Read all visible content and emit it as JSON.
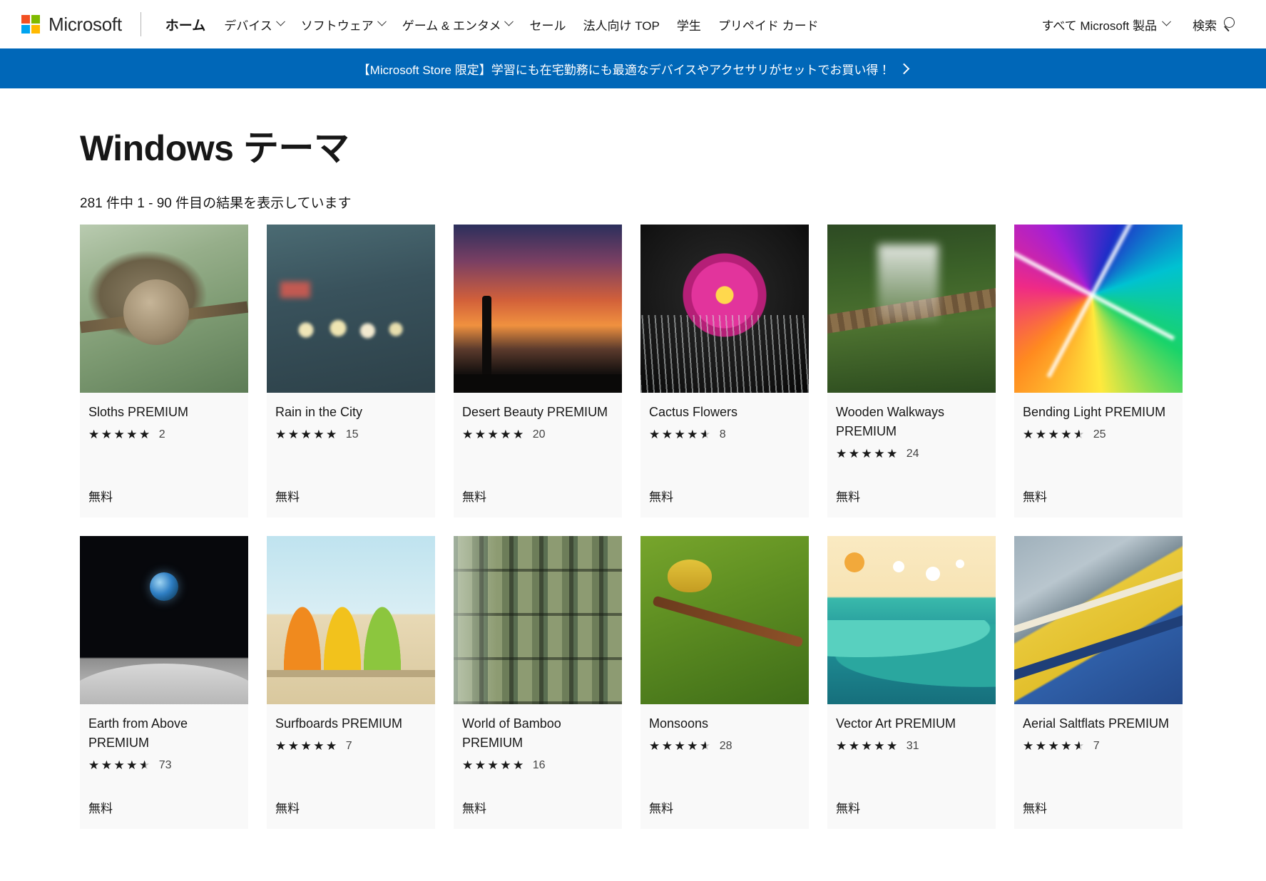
{
  "header": {
    "brand": "Microsoft",
    "logo_icon": "microsoft-logo-icon",
    "nav": [
      {
        "label": "ホーム",
        "has_chevron": false,
        "current": true
      },
      {
        "label": "デバイス",
        "has_chevron": true,
        "current": false
      },
      {
        "label": "ソフトウェア",
        "has_chevron": true,
        "current": false
      },
      {
        "label": "ゲーム & エンタメ",
        "has_chevron": true,
        "current": false
      },
      {
        "label": "セール",
        "has_chevron": false,
        "current": false
      },
      {
        "label": "法人向け TOP",
        "has_chevron": false,
        "current": false
      },
      {
        "label": "学生",
        "has_chevron": false,
        "current": false
      },
      {
        "label": "プリペイド カード",
        "has_chevron": false,
        "current": false
      }
    ],
    "all_microsoft": "すべて Microsoft 製品",
    "search_label": "検索",
    "search_icon": "search-icon"
  },
  "promo": {
    "text": "【Microsoft Store 限定】学習にも在宅勤務にも最適なデバイスやアクセサリがセットでお買い得！",
    "arrow_icon": "chevron-right-icon",
    "background": "#0067b8"
  },
  "page": {
    "title": "Windows テーマ",
    "results_text": "281 件中 1 - 90 件目の結果を表示しています"
  },
  "products": [
    {
      "title": "Sloths PREMIUM",
      "rating": 5,
      "rating_count": "2",
      "price": "無料",
      "art": "art-sloth",
      "thumb_name": "thumbnail-sloths"
    },
    {
      "title": "Rain in the City",
      "rating": 5,
      "rating_count": "15",
      "price": "無料",
      "art": "art-rain",
      "thumb_name": "thumbnail-rain-in-the-city"
    },
    {
      "title": "Desert Beauty PREMIUM",
      "rating": 5,
      "rating_count": "20",
      "price": "無料",
      "art": "art-desert",
      "thumb_name": "thumbnail-desert-beauty"
    },
    {
      "title": "Cactus Flowers",
      "rating": 4.5,
      "rating_count": "8",
      "price": "無料",
      "art": "art-cactus",
      "thumb_name": "thumbnail-cactus-flowers"
    },
    {
      "title": "Wooden Walkways PREMIUM",
      "rating": 5,
      "rating_count": "24",
      "price": "無料",
      "art": "art-walkway",
      "thumb_name": "thumbnail-wooden-walkways"
    },
    {
      "title": "Bending Light PREMIUM",
      "rating": 4.5,
      "rating_count": "25",
      "price": "無料",
      "art": "art-bending",
      "thumb_name": "thumbnail-bending-light"
    },
    {
      "title": "Earth from Above PREMIUM",
      "rating": 4.5,
      "rating_count": "73",
      "price": "無料",
      "art": "art-earth",
      "thumb_name": "thumbnail-earth-from-above"
    },
    {
      "title": "Surfboards PREMIUM",
      "rating": 5,
      "rating_count": "7",
      "price": "無料",
      "art": "art-surf",
      "thumb_name": "thumbnail-surfboards"
    },
    {
      "title": "World of Bamboo PREMIUM",
      "rating": 5,
      "rating_count": "16",
      "price": "無料",
      "art": "art-bamboo",
      "thumb_name": "thumbnail-world-of-bamboo"
    },
    {
      "title": "Monsoons",
      "rating": 4.5,
      "rating_count": "28",
      "price": "無料",
      "art": "art-monsoon",
      "thumb_name": "thumbnail-monsoons"
    },
    {
      "title": "Vector Art PREMIUM",
      "rating": 5,
      "rating_count": "31",
      "price": "無料",
      "art": "art-vector",
      "thumb_name": "thumbnail-vector-art"
    },
    {
      "title": "Aerial Saltflats PREMIUM",
      "rating": 4.5,
      "rating_count": "7",
      "price": "無料",
      "art": "art-salt",
      "thumb_name": "thumbnail-aerial-saltflats"
    }
  ],
  "colors": {
    "accent": "#0067b8",
    "logo_red": "#f25022",
    "logo_green": "#7fba00",
    "logo_blue": "#00a4ef",
    "logo_yellow": "#ffb900",
    "card_bg": "#f9f9f9",
    "star_filled": "#1a1a1a",
    "star_empty": "#bdbdbd"
  }
}
